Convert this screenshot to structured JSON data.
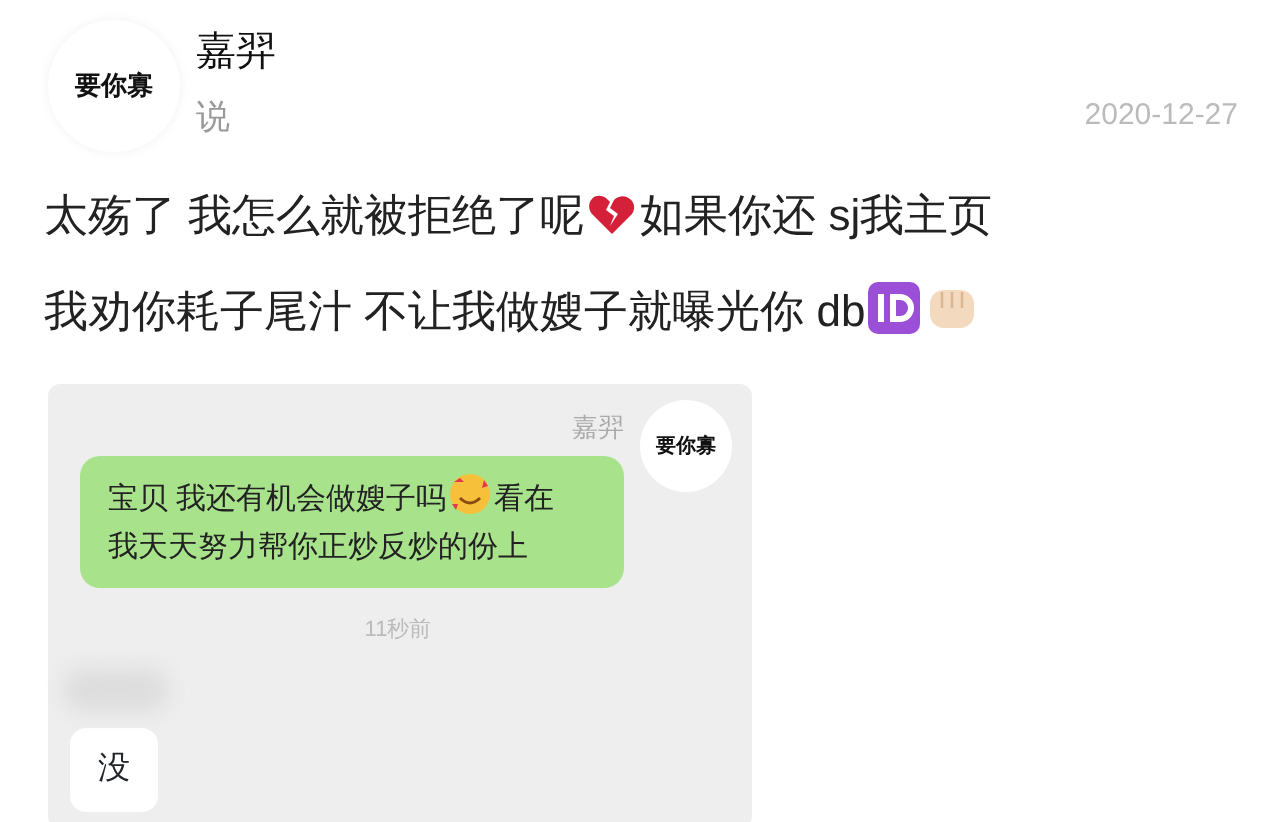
{
  "author": {
    "avatar_text": "要你寡",
    "name": "嘉羿",
    "action": "说",
    "date": "2020-12-27"
  },
  "post": {
    "text_parts": [
      "太殇了 我怎么就被拒绝了呢",
      "如果你还 sj我主页",
      "我劝你耗子尾汁 不让我做嫂子就曝光你 db"
    ]
  },
  "chat": {
    "sender_name": "嘉羿",
    "avatar_text": "要你寡",
    "message_parts": [
      "宝贝 我还有机会做嫂子吗",
      "看在",
      "我天天努力帮你正炒反炒的份上"
    ],
    "time": "11秒前",
    "reply": "没"
  }
}
